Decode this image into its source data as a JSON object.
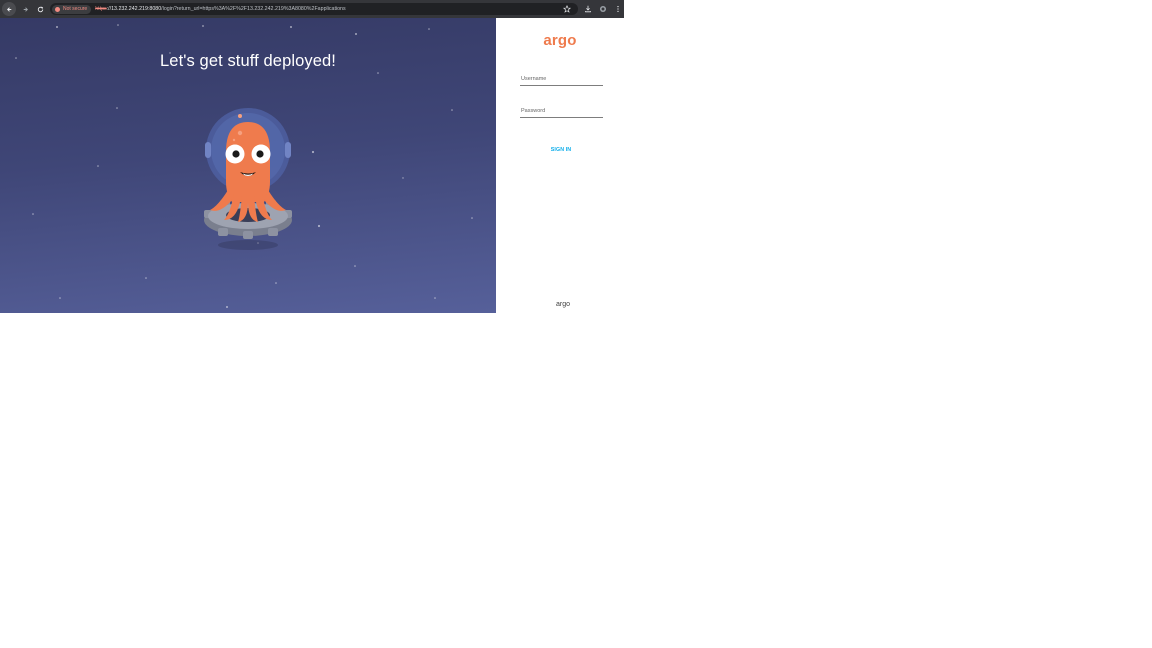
{
  "browser": {
    "security_label": "Not secure",
    "url_scheme": "https",
    "url_host": "://13.232.242.219:8080",
    "url_path": "/login?return_url=https%3A%2F%2F13.232.242.219%3A8080%2Fapplications",
    "icons": [
      "back-icon",
      "forward-icon",
      "reload-icon",
      "star-icon",
      "download-icon",
      "extension-icon",
      "menu-icon"
    ]
  },
  "hero": {
    "title": "Let's get stuff deployed!",
    "background_top": "#353a65",
    "background_bottom": "#56609a",
    "mascot_color": "#ef7b4d"
  },
  "login": {
    "logo_text": "argo",
    "username_placeholder": "Username",
    "username_value": "",
    "password_placeholder": "Password",
    "password_value": "",
    "signin_label": "SIGN IN",
    "footer_text": "argo",
    "accent_color": "#ef7b4d",
    "link_color": "#0dadea"
  }
}
